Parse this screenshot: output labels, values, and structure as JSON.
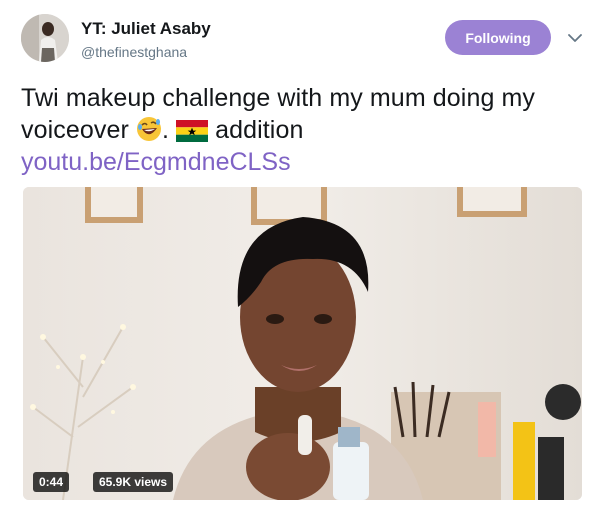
{
  "author": {
    "name": "YT: Juliet Asaby",
    "handle": "@thefinestghana",
    "avatar_icon": "profile-photo"
  },
  "follow_button": {
    "label": "Following",
    "color": "#9b82d4"
  },
  "menu_icon": "chevron-down-icon",
  "tweet": {
    "text_part1": "Twi makeup challenge with my mum doing my voiceover ",
    "emoji1": "rolling-on-floor-laughing-emoji",
    "text_part2": ". ",
    "emoji2": "ghana-flag-emoji",
    "text_part3": " addition",
    "link": "youtu.be/EcgmdneCLSs",
    "link_color": "#7f63c5"
  },
  "video": {
    "duration": "0:44",
    "views": "65.9K views"
  }
}
